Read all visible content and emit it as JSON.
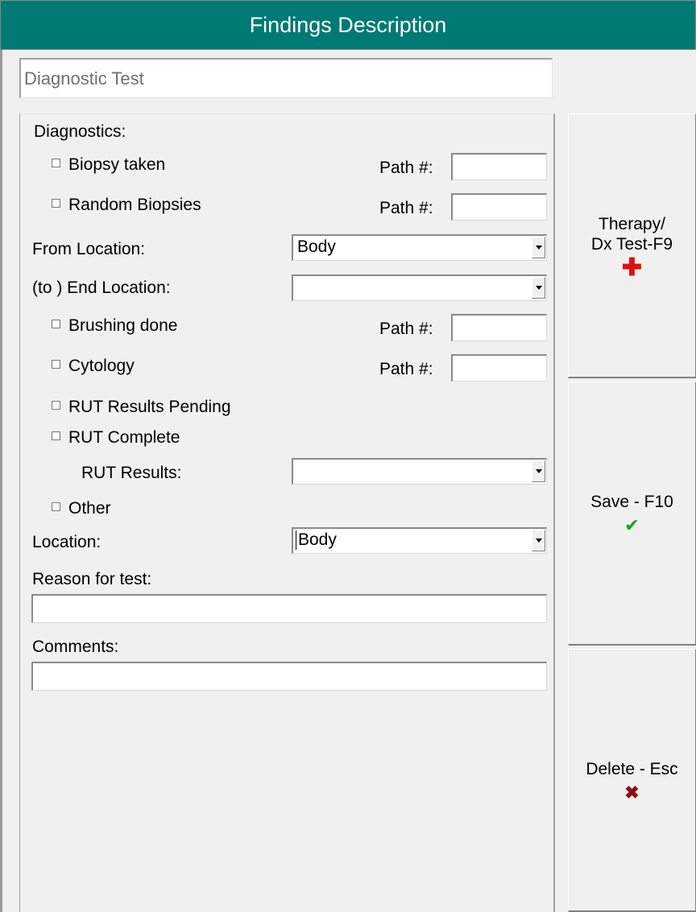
{
  "window": {
    "title": "Findings Description"
  },
  "header": {
    "finding_value": "Diagnostic Test"
  },
  "form": {
    "section_label": "Diagnostics:",
    "biopsy_taken": {
      "label": "Biopsy taken",
      "path_label": "Path #:",
      "path_value": ""
    },
    "random_biopsies": {
      "label": "Random Biopsies",
      "path_label": "Path #:",
      "path_value": ""
    },
    "from_location": {
      "label": "From Location:",
      "value": "Body"
    },
    "end_location": {
      "label": "(to ) End Location:",
      "value": ""
    },
    "brushing_done": {
      "label": "Brushing done",
      "path_label": "Path #:",
      "path_value": ""
    },
    "cytology": {
      "label": "Cytology",
      "path_label": "Path #:",
      "path_value": ""
    },
    "rut_results_pending": {
      "label": "RUT Results Pending"
    },
    "rut_complete": {
      "label": "RUT Complete"
    },
    "rut_results": {
      "label": "RUT Results:",
      "value": ""
    },
    "other": {
      "label": "Other"
    },
    "location": {
      "label": "Location:",
      "value": "Body"
    },
    "reason_for_test": {
      "label": "Reason for test:",
      "value": ""
    },
    "comments": {
      "label": "Comments:",
      "value": ""
    }
  },
  "sidebar": {
    "therapy_label": "Therapy/\nDx Test-F9",
    "therapy_icon": "red-plus-icon",
    "save_label": "Save - F10",
    "save_icon": "green-check-icon",
    "delete_label": "Delete - Esc",
    "delete_icon": "red-x-icon"
  },
  "colors": {
    "title_bar": "#007a74",
    "plus": "#e01010",
    "check": "#17a01a",
    "delete": "#8b1010"
  }
}
